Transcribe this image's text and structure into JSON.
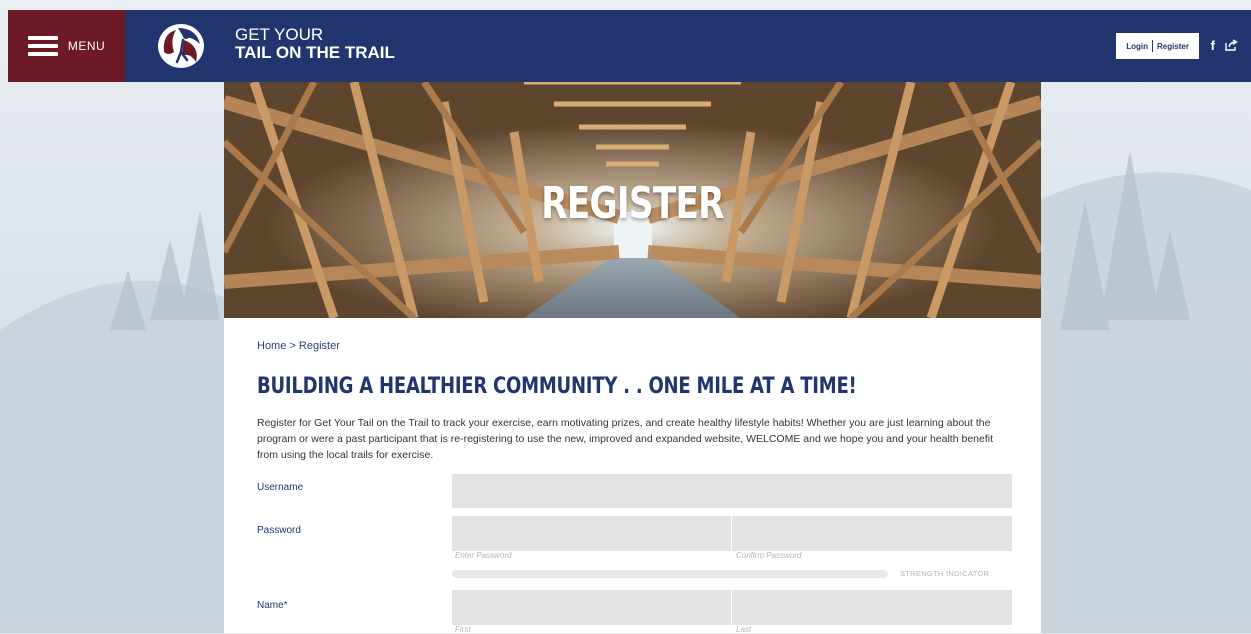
{
  "header": {
    "menu_label": "MENU",
    "brand_line1": "GET YOUR",
    "brand_line2": "TAIL ON THE TRAIL",
    "login_label": "Login",
    "register_label": "Register",
    "facebook_glyph": "f",
    "colors": {
      "nav": "#21366f",
      "menu": "#6e1a26"
    }
  },
  "hero": {
    "title": "REGISTER"
  },
  "breadcrumb": {
    "home": "Home",
    "separator": ">",
    "current": "Register"
  },
  "main": {
    "heading": "BUILDING A HEALTHIER COMMUNITY . . ONE MILE AT A TIME!",
    "intro": "Register for Get Your Tail on the Trail to track your exercise, earn motivating prizes, and create healthy lifestyle habits! Whether you are just learning about the program or were a past participant that is re-registering to use the new, improved and expanded website, WELCOME and we hope you and your health benefit from using the local trails for exercise."
  },
  "form": {
    "username_label": "Username",
    "password_label": "Password",
    "enter_password_hint": "Enter Password",
    "confirm_password_hint": "Confirm Password",
    "strength_label": "STRENGTH INDICATOR",
    "name_label": "Name",
    "required_mark": "*",
    "first_hint": "First",
    "last_hint": "Last"
  }
}
